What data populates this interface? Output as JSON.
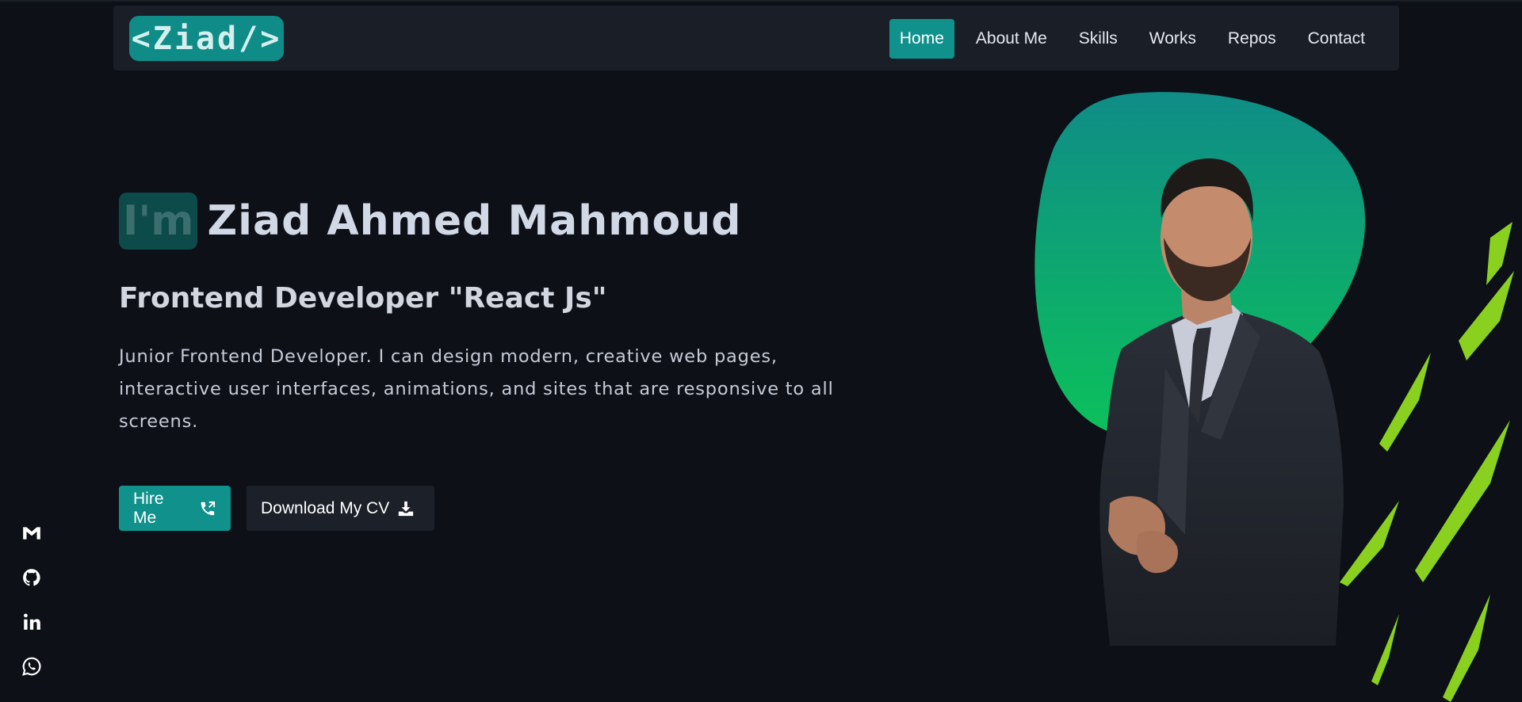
{
  "logo": {
    "text": "<Ziad/>"
  },
  "nav": {
    "items": [
      {
        "label": "Home",
        "active": true
      },
      {
        "label": "About Me",
        "active": false
      },
      {
        "label": "Skills",
        "active": false
      },
      {
        "label": "Works",
        "active": false
      },
      {
        "label": "Repos",
        "active": false
      },
      {
        "label": "Contact",
        "active": false
      }
    ]
  },
  "hero": {
    "im_badge": "I'm",
    "name": "Ziad Ahmed Mahmoud",
    "subtitle": "Frontend Developer \"React Js\"",
    "description": "Junior Frontend Developer. I can design modern, creative web pages, interactive user interfaces, animations, and sites that are responsive to all screens."
  },
  "buttons": {
    "hire": {
      "label": "Hire Me",
      "icon": "phone-icon"
    },
    "cv": {
      "label": "Download My CV",
      "icon": "download-icon"
    }
  },
  "social": [
    "gmail-icon",
    "github-icon",
    "linkedin-icon",
    "whatsapp-icon"
  ],
  "colors": {
    "background": "#0d1017",
    "accent": "#11918c",
    "navbar": "#1a1e27",
    "blob_top": "#0f8c87",
    "blob_bottom": "#0cc15a",
    "strokes": "#8ad11f"
  }
}
